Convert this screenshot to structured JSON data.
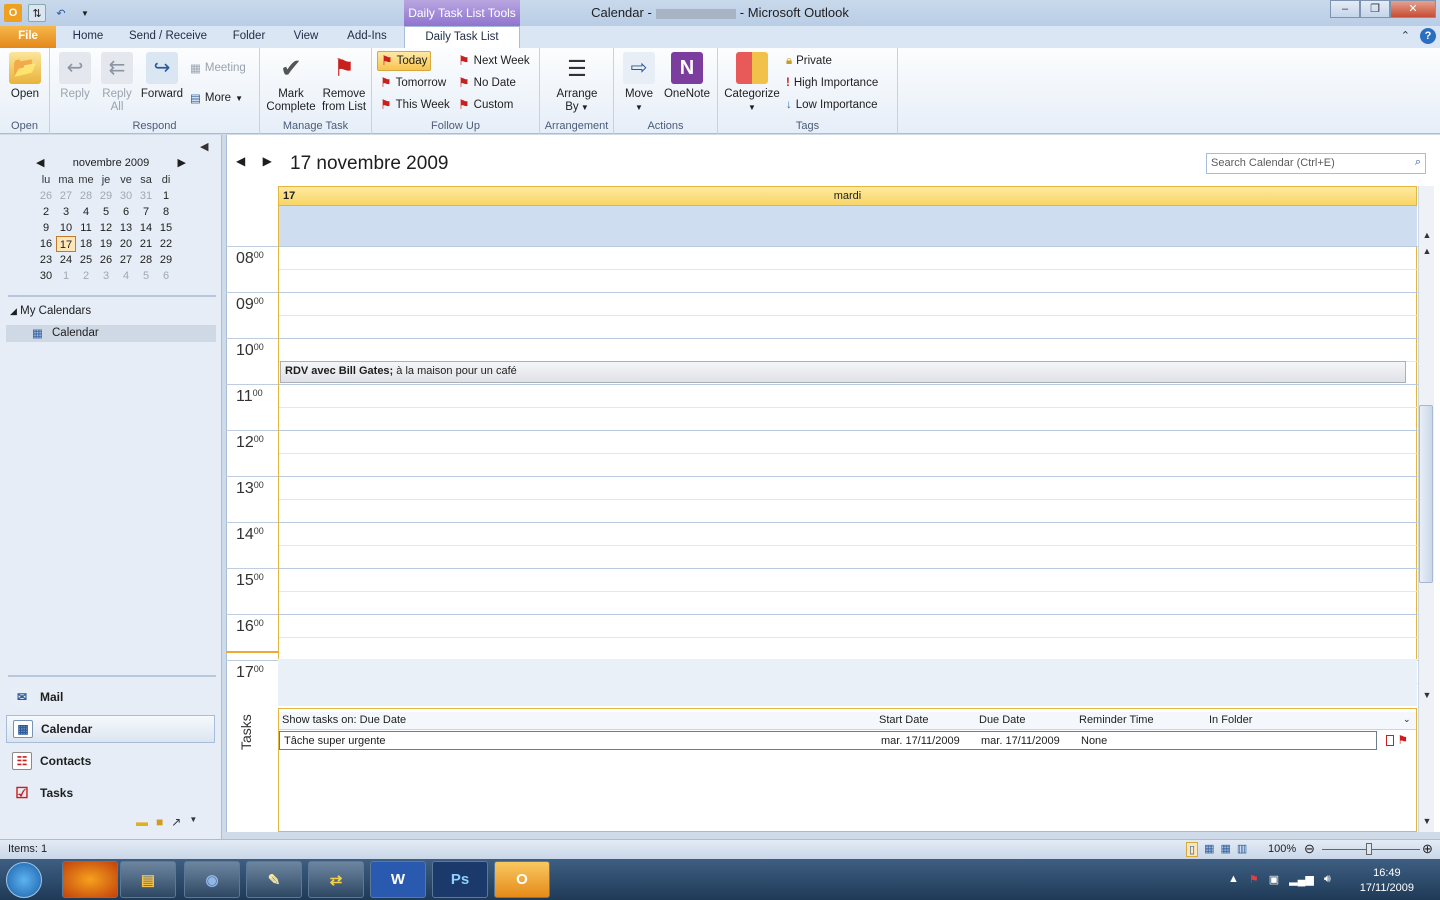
{
  "window": {
    "title_prefix": "Calendar -",
    "title_suffix": "- Microsoft Outlook",
    "context_tab": "Daily Task List Tools"
  },
  "ribbon_tabs": [
    "File",
    "Home",
    "Send / Receive",
    "Folder",
    "View",
    "Add-Ins",
    "Daily Task List"
  ],
  "ribbon": {
    "open": {
      "btn": "Open",
      "group": "Open"
    },
    "respond": {
      "reply": "Reply",
      "reply_all_1": "Reply",
      "reply_all_2": "All",
      "forward": "Forward",
      "meeting": "Meeting",
      "more": "More",
      "group": "Respond"
    },
    "manage": {
      "mark_1": "Mark",
      "mark_2": "Complete",
      "remove_1": "Remove",
      "remove_2": "from List",
      "group": "Manage Task"
    },
    "followup": {
      "today": "Today",
      "tomorrow": "Tomorrow",
      "this_week": "This Week",
      "next_week": "Next Week",
      "no_date": "No Date",
      "custom": "Custom",
      "group": "Follow Up"
    },
    "arrangement": {
      "arrange_1": "Arrange",
      "arrange_2": "By",
      "group": "Arrangement"
    },
    "actions": {
      "move": "Move",
      "onenote": "OneNote",
      "group": "Actions"
    },
    "tags": {
      "categorize": "Categorize",
      "private": "Private",
      "high": "High Importance",
      "low": "Low Importance",
      "group": "Tags"
    }
  },
  "minical": {
    "month": "novembre 2009",
    "dow": [
      "lu",
      "ma",
      "me",
      "je",
      "ve",
      "sa",
      "di"
    ],
    "weeks": [
      [
        "26",
        "27",
        "28",
        "29",
        "30",
        "31",
        "1"
      ],
      [
        "2",
        "3",
        "4",
        "5",
        "6",
        "7",
        "8"
      ],
      [
        "9",
        "10",
        "11",
        "12",
        "13",
        "14",
        "15"
      ],
      [
        "16",
        "17",
        "18",
        "19",
        "20",
        "21",
        "22"
      ],
      [
        "23",
        "24",
        "25",
        "26",
        "27",
        "28",
        "29"
      ],
      [
        "30",
        "1",
        "2",
        "3",
        "4",
        "5",
        "6"
      ]
    ]
  },
  "folders": {
    "my_calendars": "My Calendars",
    "calendar": "Calendar"
  },
  "nav": {
    "mail": "Mail",
    "calendar": "Calendar",
    "contacts": "Contacts",
    "tasks": "Tasks"
  },
  "calendar": {
    "date_title": "17 novembre 2009",
    "search_placeholder": "Search Calendar (Ctrl+E)",
    "day_number": "17",
    "day_name": "mardi",
    "hours": [
      "08",
      "09",
      "10",
      "11",
      "12",
      "13",
      "14",
      "15",
      "16",
      "17"
    ],
    "minutes": "00",
    "appointment_bold": "RDV avec Bill Gates;",
    "appointment_rest": " à la maison pour un café"
  },
  "tasks": {
    "label": "Tasks",
    "header_show": "Show tasks on: Due Date",
    "col_start": "Start Date",
    "col_due": "Due Date",
    "col_reminder": "Reminder Time",
    "col_folder": "In Folder",
    "row": {
      "subject": "Tâche super urgente",
      "start": "mar. 17/11/2009",
      "due": "mar. 17/11/2009",
      "reminder": "None"
    }
  },
  "status": {
    "items": "Items: 1",
    "zoom": "100%"
  },
  "clock": {
    "time": "16:49",
    "date": "17/11/2009"
  },
  "colors": {
    "accent": "#f8d565",
    "file_tab": "#e4881b",
    "flag": "#c8201e"
  }
}
